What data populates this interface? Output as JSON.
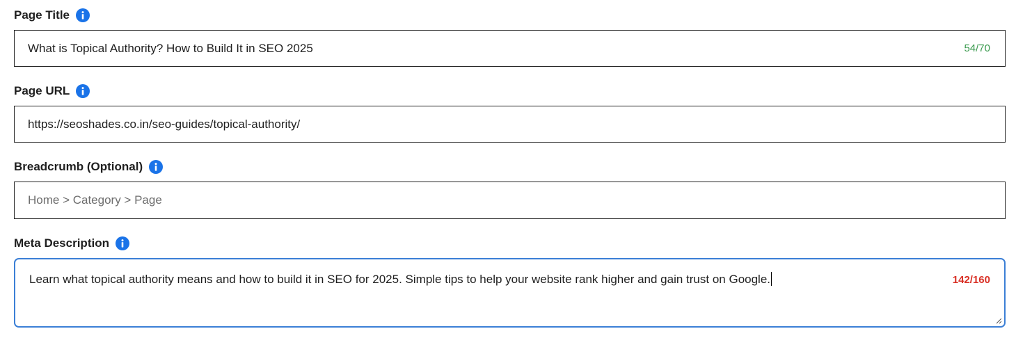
{
  "fields": {
    "title": {
      "label": "Page Title",
      "value": "What is Topical Authority? How to Build It in SEO 2025",
      "counter": "54/70"
    },
    "url": {
      "label": "Page URL",
      "value": "https://seoshades.co.in/seo-guides/topical-authority/"
    },
    "breadcrumb": {
      "label": "Breadcrumb (Optional)",
      "placeholder": "Home > Category > Page"
    },
    "meta": {
      "label": "Meta Description",
      "value": "Learn what topical authority means and how to build it in SEO for 2025. Simple tips to help your website rank higher and gain trust on Google.",
      "counter": "142/160"
    }
  },
  "colors": {
    "info_icon": "#1a73e8",
    "counter_ok": "#3a9a4e",
    "counter_over": "#d93025",
    "focus_border": "#3b7fd6"
  },
  "icons": {
    "info": "info-icon",
    "resize": "resize-handle-icon"
  }
}
